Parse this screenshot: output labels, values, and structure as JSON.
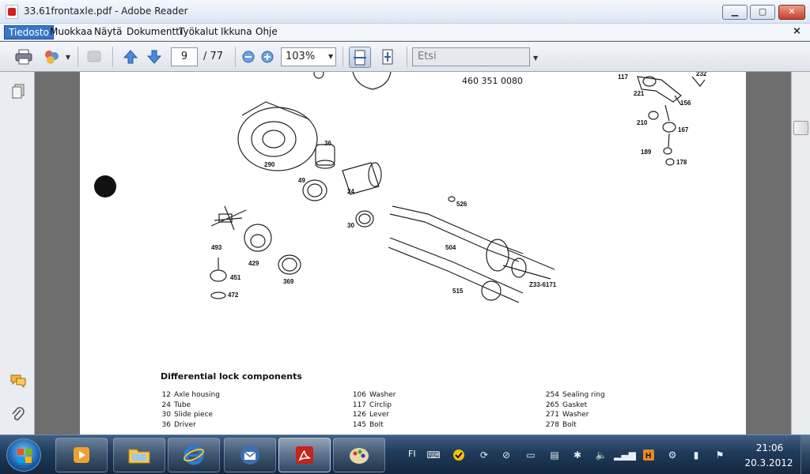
{
  "window": {
    "title": "33.61frontaxle.pdf - Adobe Reader"
  },
  "menu": {
    "items": [
      "Tiedosto",
      "Muokkaa",
      "Näytä",
      "Dokumentti",
      "Työkalut",
      "Ikkuna",
      "Ohje"
    ],
    "active": "Tiedosto"
  },
  "toolbar": {
    "page_current": "9",
    "page_total": "/ 77",
    "zoom": "103%",
    "search_placeholder": "Etsi"
  },
  "document": {
    "ref_number": "460 351 0080",
    "heading": "Differential lock components",
    "diagram_labels": [
      "36",
      "290",
      "49",
      "24",
      "526",
      "30",
      "493",
      "429",
      "504",
      "451",
      "369",
      "472",
      "515",
      "Z33-6171",
      "117",
      "232",
      "221",
      "156",
      "210",
      "167",
      "189",
      "178"
    ],
    "parts": [
      [
        {
          "no": "12",
          "name": "Axle housing"
        },
        {
          "no": "24",
          "name": "Tube"
        },
        {
          "no": "30",
          "name": "Slide piece"
        },
        {
          "no": "36",
          "name": "Driver"
        }
      ],
      [
        {
          "no": "106",
          "name": "Washer"
        },
        {
          "no": "117",
          "name": "Circlip"
        },
        {
          "no": "126",
          "name": "Lever"
        },
        {
          "no": "145",
          "name": "Bolt"
        }
      ],
      [
        {
          "no": "254",
          "name": "Sealing ring"
        },
        {
          "no": "265",
          "name": "Gasket"
        },
        {
          "no": "271",
          "name": "Washer"
        },
        {
          "no": "278",
          "name": "Bolt"
        }
      ]
    ]
  },
  "taskbar": {
    "apps": [
      "media-player",
      "file-explorer",
      "internet-explorer",
      "thunderbird",
      "adobe-reader",
      "paint"
    ],
    "active_app": "adobe-reader",
    "language": "FI",
    "time": "21:06",
    "date": "20.3.2012"
  }
}
